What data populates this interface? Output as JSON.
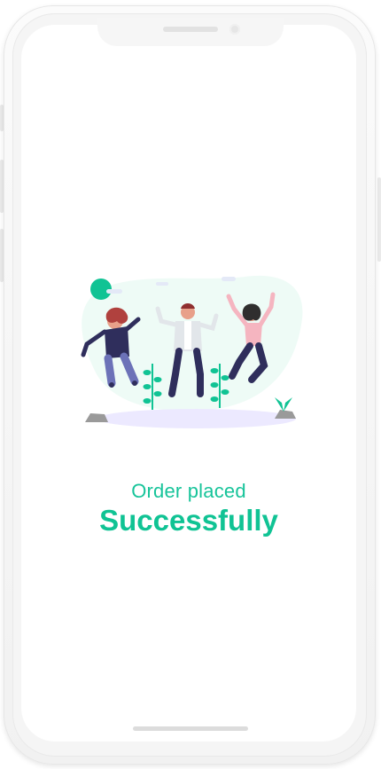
{
  "message": {
    "line1": "Order placed",
    "line2": "Successfully"
  },
  "colors": {
    "accent": "#10c394",
    "blob": "#eefbf6",
    "shadow": "#ece9ff"
  },
  "illustration": {
    "name": "people-jumping-celebration"
  }
}
